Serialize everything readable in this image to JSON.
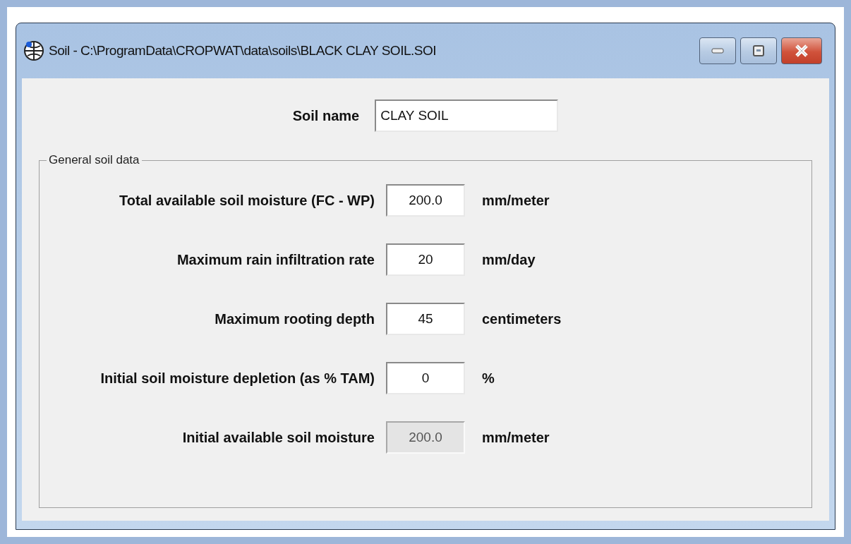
{
  "window": {
    "title": "Soil - C:\\ProgramData\\CROPWAT\\data\\soils\\BLACK CLAY SOIL.SOI"
  },
  "soil_name": {
    "label": "Soil name",
    "value": "CLAY SOIL"
  },
  "group": {
    "title": "General soil data",
    "rows": [
      {
        "label": "Total available soil moisture (FC - WP)",
        "value": "200.0",
        "unit": "mm/meter",
        "disabled": false
      },
      {
        "label": "Maximum rain infiltration rate",
        "value": "20",
        "unit": "mm/day",
        "disabled": false
      },
      {
        "label": "Maximum rooting depth",
        "value": "45",
        "unit": "centimeters",
        "disabled": false
      },
      {
        "label": "Initial soil moisture depletion (as % TAM)",
        "value": "0",
        "unit": "%",
        "disabled": false
      },
      {
        "label": "Initial available soil moisture",
        "value": "200.0",
        "unit": "mm/meter",
        "disabled": true
      }
    ]
  }
}
